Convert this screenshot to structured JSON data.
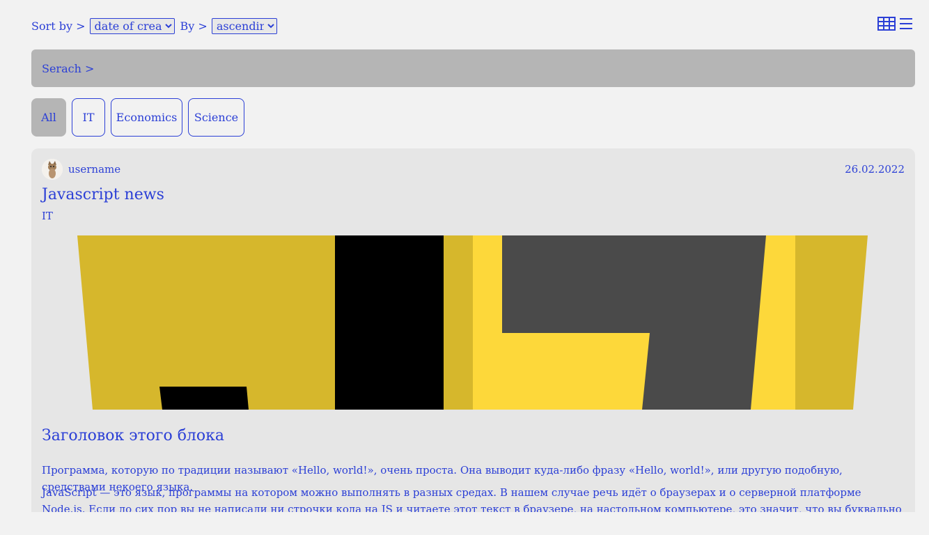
{
  "controls": {
    "sort_label": "Sort by >",
    "sort_value": "date of creation",
    "order_label": "By >",
    "order_value": "ascending"
  },
  "view_icons": {
    "grid": "grid-view-icon",
    "list": "list-view-icon"
  },
  "search": {
    "label": "Serach >"
  },
  "categories": [
    "All",
    "IT",
    "Economics",
    "Science"
  ],
  "post": {
    "username": "username",
    "date": "26.02.2022",
    "title": "Javascript news",
    "tag": "IT",
    "heading": "Заголовок этого блока",
    "paragraph1": "Программа, которую по традиции называют «Hello, world!», очень проста. Она выводит куда-либо фразу «Hello, world!», или другую подобную, средствами некоего языка.",
    "paragraph2": "JavaScript — это язык, программы на котором можно выполнять в разных средах. В нашем случае речь идёт о браузерах и о серверной платформе Node.js. Если до сих пор вы не написали ни строчки кода на JS и читаете этот текст в браузере, на настольном компьютере, это значит, что вы буквально в считанных секундах от своей первой JavaScript-программы."
  },
  "colors": {
    "accent": "#2b3fd6",
    "js_yellow": "#d6b72c",
    "js_bright": "#fdd83a",
    "js_dark": "#4a4a4a"
  }
}
